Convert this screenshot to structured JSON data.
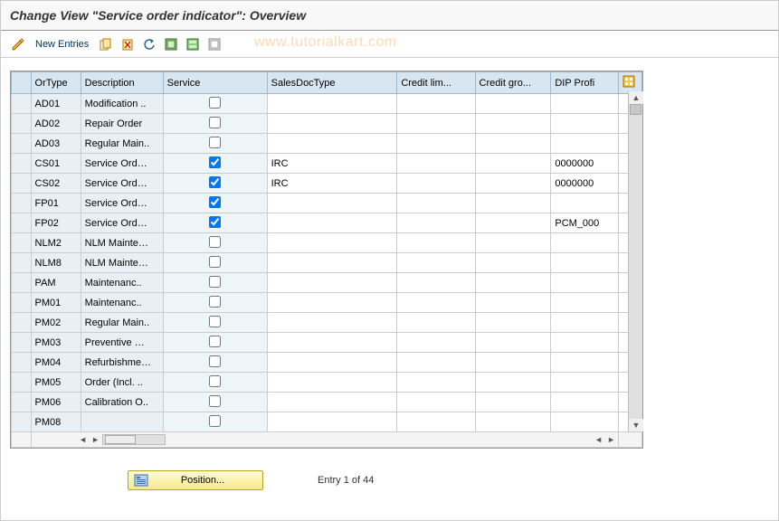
{
  "title": "Change View \"Service order indicator\": Overview",
  "toolbar": {
    "new_entries_label": "New Entries"
  },
  "watermark": "www.tutorialkart.com",
  "columns": {
    "ortype": "OrType",
    "description": "Description",
    "service": "Service",
    "salesdoctype": "SalesDocType",
    "creditlim": "Credit lim...",
    "creditgro": "Credit gro...",
    "dipprofi": "DIP Profi"
  },
  "rows": [
    {
      "ortype": "AD01",
      "desc": "Modification ..",
      "service": false,
      "sdt": "",
      "cl": "",
      "cg": "",
      "dip": ""
    },
    {
      "ortype": "AD02",
      "desc": "Repair Order",
      "service": false,
      "sdt": "",
      "cl": "",
      "cg": "",
      "dip": ""
    },
    {
      "ortype": "AD03",
      "desc": "Regular Main..",
      "service": false,
      "sdt": "",
      "cl": "",
      "cg": "",
      "dip": ""
    },
    {
      "ortype": "CS01",
      "desc": "Service Ord…",
      "service": true,
      "sdt": "IRC",
      "cl": "",
      "cg": "",
      "dip": "0000000"
    },
    {
      "ortype": "CS02",
      "desc": "Service Ord…",
      "service": true,
      "sdt": "IRC",
      "cl": "",
      "cg": "",
      "dip": "0000000"
    },
    {
      "ortype": "FP01",
      "desc": "Service Ord…",
      "service": true,
      "sdt": "",
      "cl": "",
      "cg": "",
      "dip": ""
    },
    {
      "ortype": "FP02",
      "desc": "Service Ord…",
      "service": true,
      "sdt": "",
      "cl": "",
      "cg": "",
      "dip": "PCM_000"
    },
    {
      "ortype": "NLM2",
      "desc": "NLM Mainte…",
      "service": false,
      "sdt": "",
      "cl": "",
      "cg": "",
      "dip": ""
    },
    {
      "ortype": "NLM8",
      "desc": "NLM Mainte…",
      "service": false,
      "sdt": "",
      "cl": "",
      "cg": "",
      "dip": ""
    },
    {
      "ortype": "PAM",
      "desc": "Maintenanc..",
      "service": false,
      "sdt": "",
      "cl": "",
      "cg": "",
      "dip": ""
    },
    {
      "ortype": "PM01",
      "desc": "Maintenanc..",
      "service": false,
      "sdt": "",
      "cl": "",
      "cg": "",
      "dip": ""
    },
    {
      "ortype": "PM02",
      "desc": "Regular Main..",
      "service": false,
      "sdt": "",
      "cl": "",
      "cg": "",
      "dip": ""
    },
    {
      "ortype": "PM03",
      "desc": "Preventive …",
      "service": false,
      "sdt": "",
      "cl": "",
      "cg": "",
      "dip": ""
    },
    {
      "ortype": "PM04",
      "desc": "Refurbishme…",
      "service": false,
      "sdt": "",
      "cl": "",
      "cg": "",
      "dip": ""
    },
    {
      "ortype": "PM05",
      "desc": "Order (Incl. ..",
      "service": false,
      "sdt": "",
      "cl": "",
      "cg": "",
      "dip": ""
    },
    {
      "ortype": "PM06",
      "desc": "Calibration O..",
      "service": false,
      "sdt": "",
      "cl": "",
      "cg": "",
      "dip": ""
    },
    {
      "ortype": "PM08",
      "desc": "",
      "service": false,
      "sdt": "",
      "cl": "",
      "cg": "",
      "dip": ""
    }
  ],
  "footer": {
    "position_label": "Position...",
    "entry_text": "Entry 1 of 44"
  }
}
